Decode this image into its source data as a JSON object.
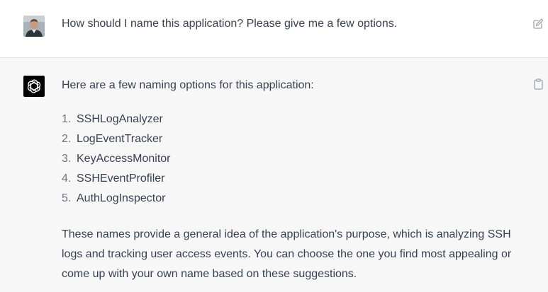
{
  "conversation": {
    "user_message": {
      "avatar_icon": "user-photo-avatar",
      "text": "How should I name this application? Please give me a few options.",
      "edit_icon": "edit-icon"
    },
    "assistant_message": {
      "avatar_icon": "openai-logo-icon",
      "intro": "Here are a few naming options for this application:",
      "options": [
        {
          "num": "1.",
          "name": "SSHLogAnalyzer"
        },
        {
          "num": "2.",
          "name": "LogEventTracker"
        },
        {
          "num": "3.",
          "name": "KeyAccessMonitor"
        },
        {
          "num": "4.",
          "name": "SSHEventProfiler"
        },
        {
          "num": "5.",
          "name": "AuthLogInspector"
        }
      ],
      "summary": "These names provide a general idea of the application's purpose, which is analyzing SSH logs and tracking user access events. You can choose the one you find most appealing or come up with your own name based on these suggestions.",
      "copy_icon": "clipboard-icon"
    }
  },
  "colors": {
    "text": "#374151",
    "assistant_bg": "#f7f7f8",
    "user_bg": "#ffffff",
    "bot_avatar_bg": "#000000",
    "icon_gray": "#9ca3af"
  }
}
